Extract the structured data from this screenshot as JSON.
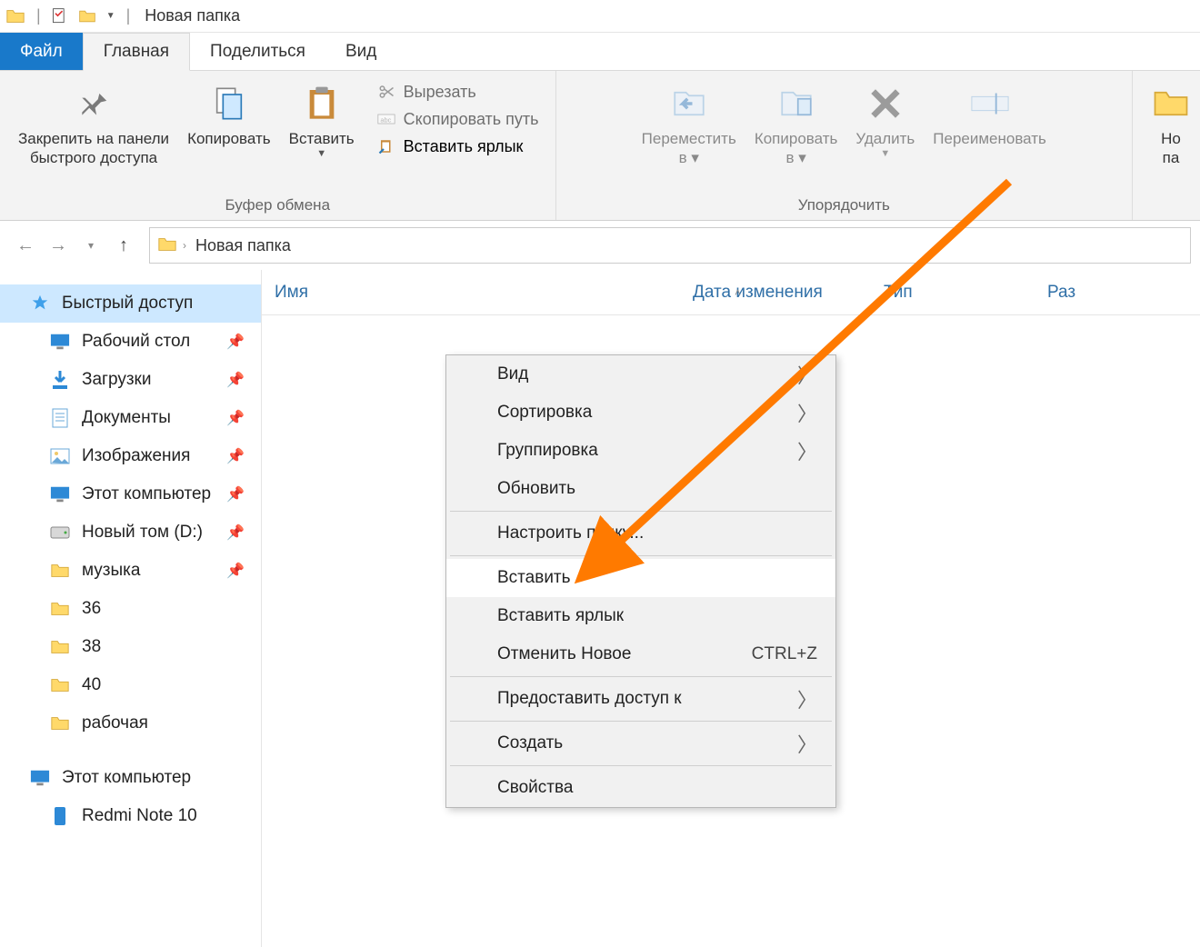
{
  "titlebar": {
    "title": "Новая папка"
  },
  "tabs": {
    "file": "Файл",
    "home": "Главная",
    "share": "Поделиться",
    "view": "Вид"
  },
  "ribbon": {
    "clipboard": {
      "label": "Буфер обмена",
      "pin": "Закрепить на панели\nбыстрого доступа",
      "copy": "Копировать",
      "paste": "Вставить",
      "cut": "Вырезать",
      "copy_path": "Скопировать путь",
      "paste_shortcut": "Вставить ярлык"
    },
    "organize": {
      "label": "Упорядочить",
      "move_to": "Переместить\nв ▾",
      "copy_to": "Копировать\nв ▾",
      "delete": "Удалить",
      "rename": "Переименовать"
    },
    "new": {
      "folder": "Но\nпа"
    }
  },
  "breadcrumb": {
    "current": "Новая папка"
  },
  "columns": {
    "name": "Имя",
    "date": "Дата изменения",
    "type": "Тип",
    "size": "Раз"
  },
  "sidebar": {
    "quick_access": "Быстрый доступ",
    "items": [
      {
        "label": "Рабочий стол",
        "icon": "desktop",
        "pinned": true
      },
      {
        "label": "Загрузки",
        "icon": "downloads",
        "pinned": true
      },
      {
        "label": "Документы",
        "icon": "documents",
        "pinned": true
      },
      {
        "label": "Изображения",
        "icon": "pictures",
        "pinned": true
      },
      {
        "label": "Этот компьютер",
        "icon": "thispc",
        "pinned": true
      },
      {
        "label": "Новый том (D:)",
        "icon": "drive",
        "pinned": true
      },
      {
        "label": "музыка",
        "icon": "folder",
        "pinned": true
      },
      {
        "label": "36",
        "icon": "folder",
        "pinned": false
      },
      {
        "label": "38",
        "icon": "folder",
        "pinned": false
      },
      {
        "label": "40",
        "icon": "folder",
        "pinned": false
      },
      {
        "label": "рабочая",
        "icon": "folder",
        "pinned": false
      }
    ],
    "this_pc": "Этот компьютер",
    "device": "Redmi Note 10"
  },
  "context_menu": {
    "items": [
      {
        "label": "Вид",
        "submenu": true
      },
      {
        "label": "Сортировка",
        "submenu": true
      },
      {
        "label": "Группировка",
        "submenu": true
      },
      {
        "label": "Обновить"
      },
      {
        "sep": true
      },
      {
        "label": "Настроить папку..."
      },
      {
        "sep": true
      },
      {
        "label": "Вставить",
        "hover": true
      },
      {
        "label": "Вставить ярлык"
      },
      {
        "label": "Отменить Новое",
        "shortcut": "CTRL+Z"
      },
      {
        "sep": true
      },
      {
        "label": "Предоставить доступ к",
        "submenu": true
      },
      {
        "sep": true
      },
      {
        "label": "Создать",
        "submenu": true
      },
      {
        "sep": true
      },
      {
        "label": "Свойства"
      }
    ]
  },
  "colors": {
    "accent": "#1979ca",
    "arrow": "#ff7a00"
  }
}
